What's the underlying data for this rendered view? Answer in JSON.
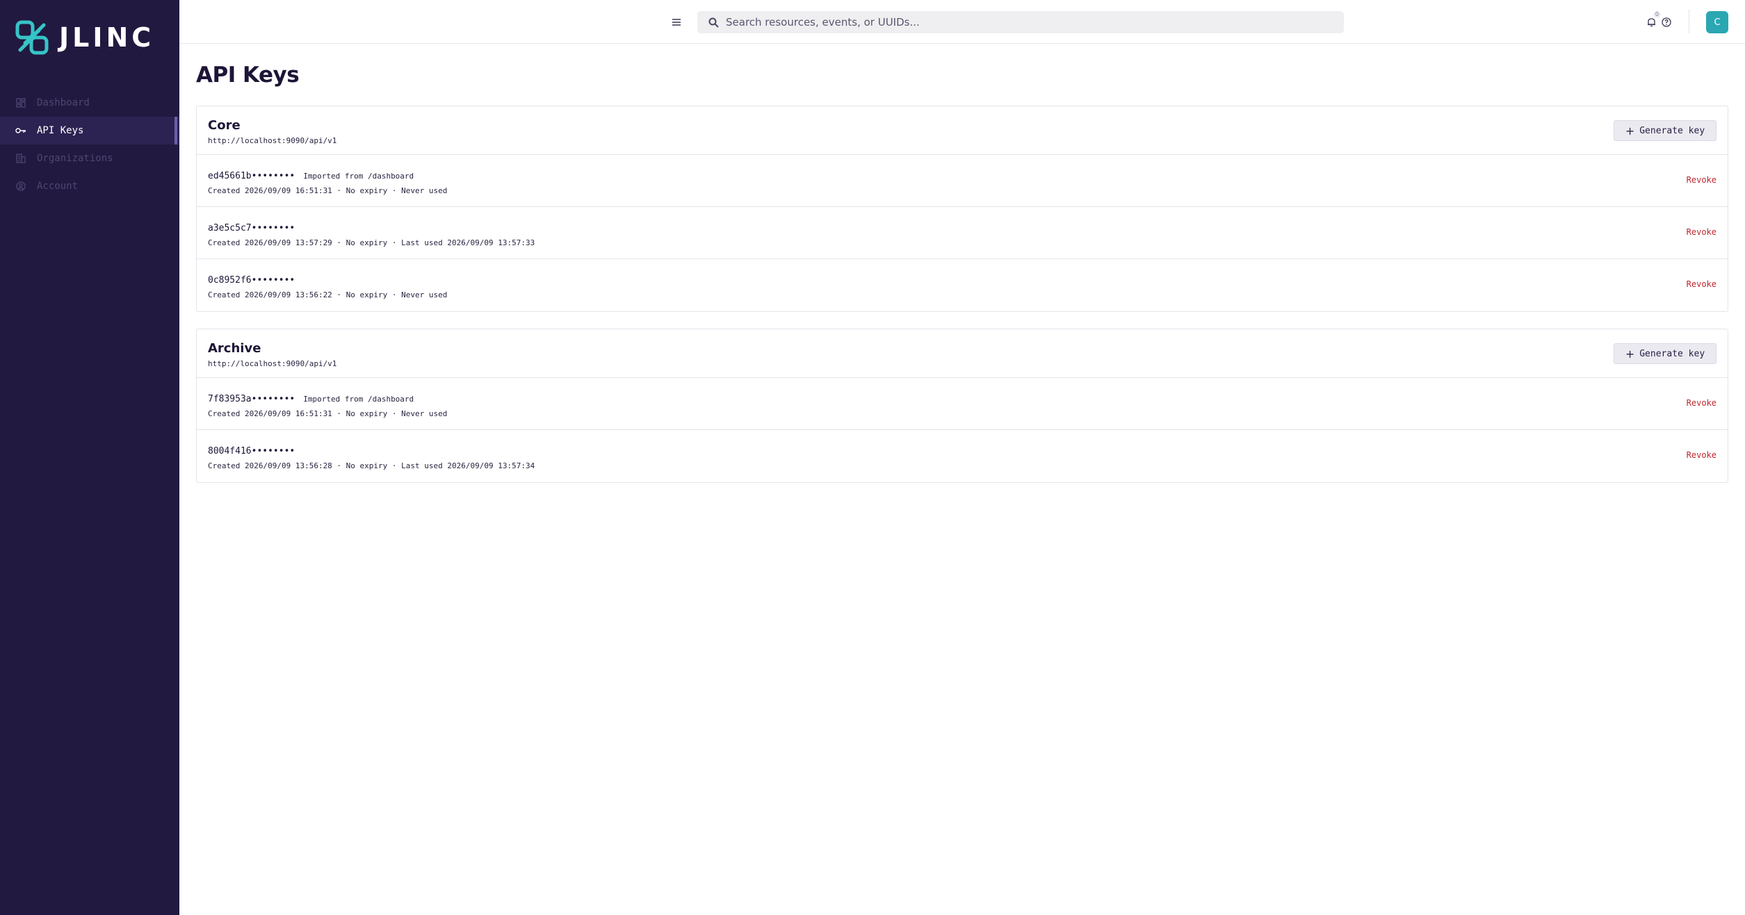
{
  "brand": {
    "name": "JLINC",
    "accent": "#36c4c7",
    "sidebar_bg": "#221940"
  },
  "sidebar": {
    "items": [
      {
        "label": "Dashboard",
        "icon": "dashboard-icon",
        "active": false
      },
      {
        "label": "API Keys",
        "icon": "key-icon",
        "active": true
      },
      {
        "label": "Organizations",
        "icon": "building-icon",
        "active": false
      },
      {
        "label": "Account",
        "icon": "account-icon",
        "active": false
      }
    ]
  },
  "header": {
    "search_placeholder": "Search resources, events, or UUIDs...",
    "notifications_count": "0",
    "avatar_initial": "C",
    "avatar_color": "#2aa7b2"
  },
  "page": {
    "title": "API Keys"
  },
  "groups": [
    {
      "name": "Core",
      "url": "http://localhost:9090/api/v1",
      "generate_label": "Generate key",
      "keys": [
        {
          "id": "ed45661b••••••••",
          "note": "Imported from /dashboard",
          "meta": "Created 2026/09/09 16:51:31 · No expiry · Never used",
          "action": "Revoke"
        },
        {
          "id": "a3e5c5c7••••••••",
          "note": "",
          "meta": "Created 2026/09/09 13:57:29 · No expiry · Last used 2026/09/09 13:57:33",
          "action": "Revoke"
        },
        {
          "id": "0c8952f6••••••••",
          "note": "",
          "meta": "Created 2026/09/09 13:56:22 · No expiry · Never used",
          "action": "Revoke"
        }
      ]
    },
    {
      "name": "Archive",
      "url": "http://localhost:9090/api/v1",
      "generate_label": "Generate key",
      "keys": [
        {
          "id": "7f83953a••••••••",
          "note": "Imported from /dashboard",
          "meta": "Created 2026/09/09 16:51:31 · No expiry · Never used",
          "action": "Revoke"
        },
        {
          "id": "8004f416••••••••",
          "note": "",
          "meta": "Created 2026/09/09 13:56:28 · No expiry · Last used 2026/09/09 13:57:34",
          "action": "Revoke"
        }
      ]
    }
  ]
}
